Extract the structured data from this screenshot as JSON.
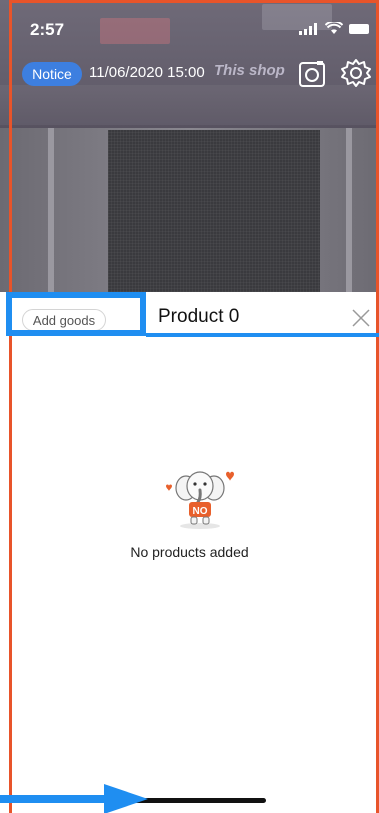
{
  "status_bar": {
    "time": "2:57"
  },
  "camera_view": {
    "notice_label": "Notice",
    "datetime": "11/06/2020 15:00",
    "shop_logo": "This shop"
  },
  "sheet": {
    "add_goods_label": "Add goods",
    "title": "Product 0",
    "empty_message": "No products added",
    "badge_text": "NO"
  },
  "colors": {
    "notice_blue": "#3d7fe0",
    "annotation_blue": "#1f8ef1",
    "annotation_red": "#e8542a",
    "elephant_orange": "#e8602c"
  },
  "icons": [
    "camera-switch-icon",
    "gear-icon",
    "close-icon",
    "empty-elephant-icon"
  ]
}
